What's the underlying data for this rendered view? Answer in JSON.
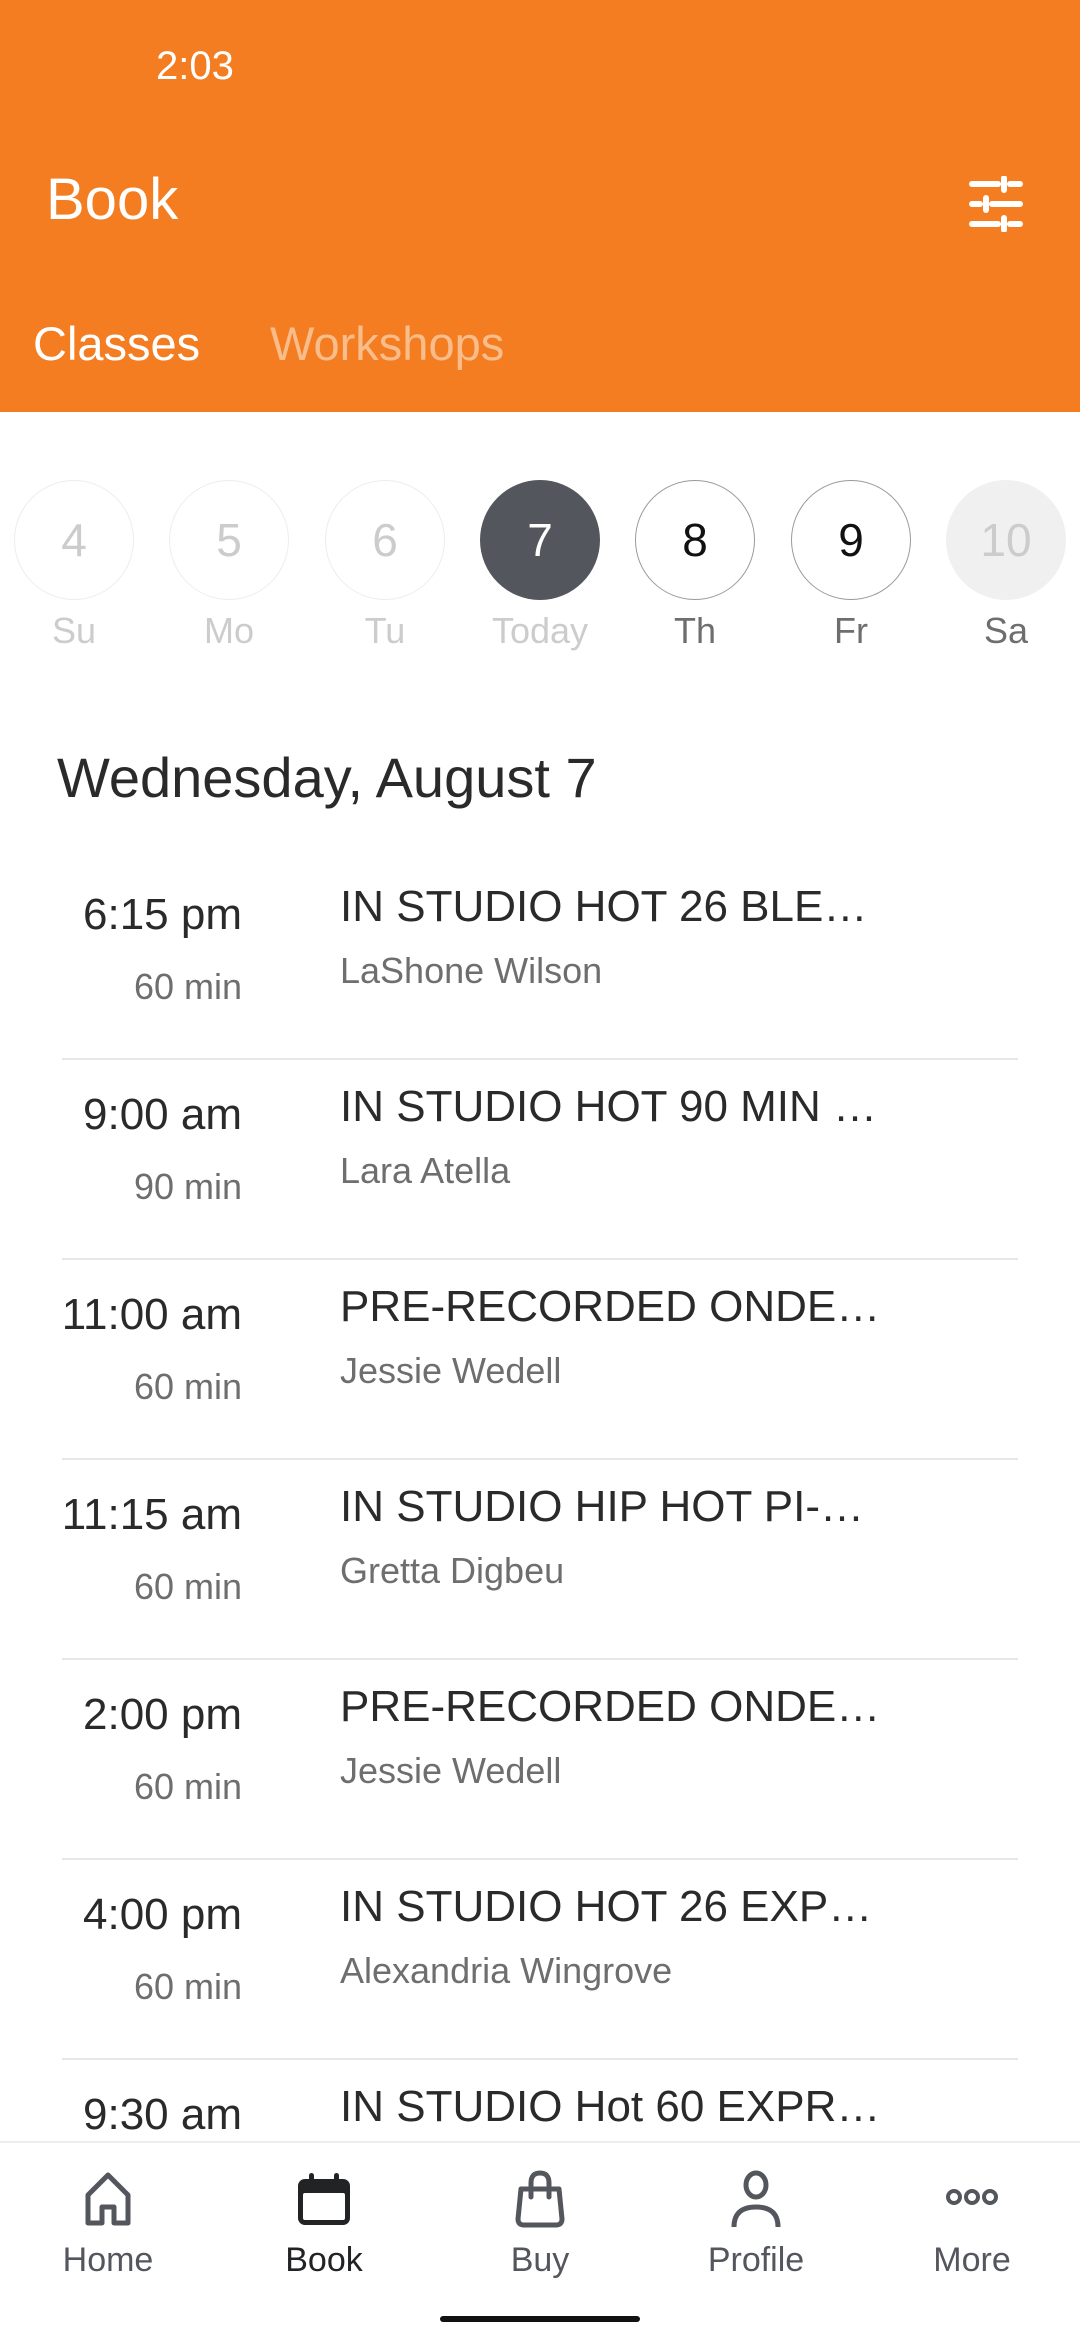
{
  "status_bar": {
    "time": "2:03"
  },
  "header": {
    "title": "Book",
    "filter_icon": "tune-icon",
    "tabs": [
      {
        "label": "Classes",
        "active": true
      },
      {
        "label": "Workshops",
        "active": false
      }
    ]
  },
  "colors": {
    "brand": "#F47D22",
    "selected_day": "#53565C",
    "inactive_tab": "#F8BD8A"
  },
  "days": [
    {
      "number": "4",
      "label": "Su",
      "state": "past"
    },
    {
      "number": "5",
      "label": "Mo",
      "state": "past"
    },
    {
      "number": "6",
      "label": "Tu",
      "state": "past"
    },
    {
      "number": "7",
      "label": "Today",
      "state": "today"
    },
    {
      "number": "8",
      "label": "Th",
      "state": "future"
    },
    {
      "number": "9",
      "label": "Fr",
      "state": "future"
    },
    {
      "number": "10",
      "label": "Sa",
      "state": "disabled"
    }
  ],
  "section_date": "Wednesday, August 7",
  "classes": [
    {
      "time": "6:15 pm",
      "duration": "60 min",
      "name": "IN STUDIO HOT 26 BLE…",
      "instructor": "LaShone Wilson"
    },
    {
      "time": "9:00 am",
      "duration": "90 min",
      "name": "IN STUDIO HOT 90 MIN …",
      "instructor": "Lara Atella"
    },
    {
      "time": "11:00 am",
      "duration": "60 min",
      "name": "PRE-RECORDED ONDE…",
      "instructor": "Jessie Wedell"
    },
    {
      "time": "11:15 am",
      "duration": "60 min",
      "name": "IN STUDIO HIP HOT PI-…",
      "instructor": "Gretta Digbeu"
    },
    {
      "time": "2:00 pm",
      "duration": "60 min",
      "name": "PRE-RECORDED ONDE…",
      "instructor": "Jessie Wedell"
    },
    {
      "time": "4:00 pm",
      "duration": "60 min",
      "name": "IN STUDIO HOT 26 EXP…",
      "instructor": "Alexandria Wingrove"
    },
    {
      "time": "9:30 am",
      "duration": "",
      "name": "IN STUDIO Hot 60 EXPR…",
      "instructor": ""
    }
  ],
  "bottom_nav": [
    {
      "label": "Home",
      "icon": "home-icon",
      "active": false
    },
    {
      "label": "Book",
      "icon": "calendar-icon",
      "active": true
    },
    {
      "label": "Buy",
      "icon": "shopping-bag-icon",
      "active": false
    },
    {
      "label": "Profile",
      "icon": "person-icon",
      "active": false
    },
    {
      "label": "More",
      "icon": "more-horizontal-icon",
      "active": false
    }
  ]
}
